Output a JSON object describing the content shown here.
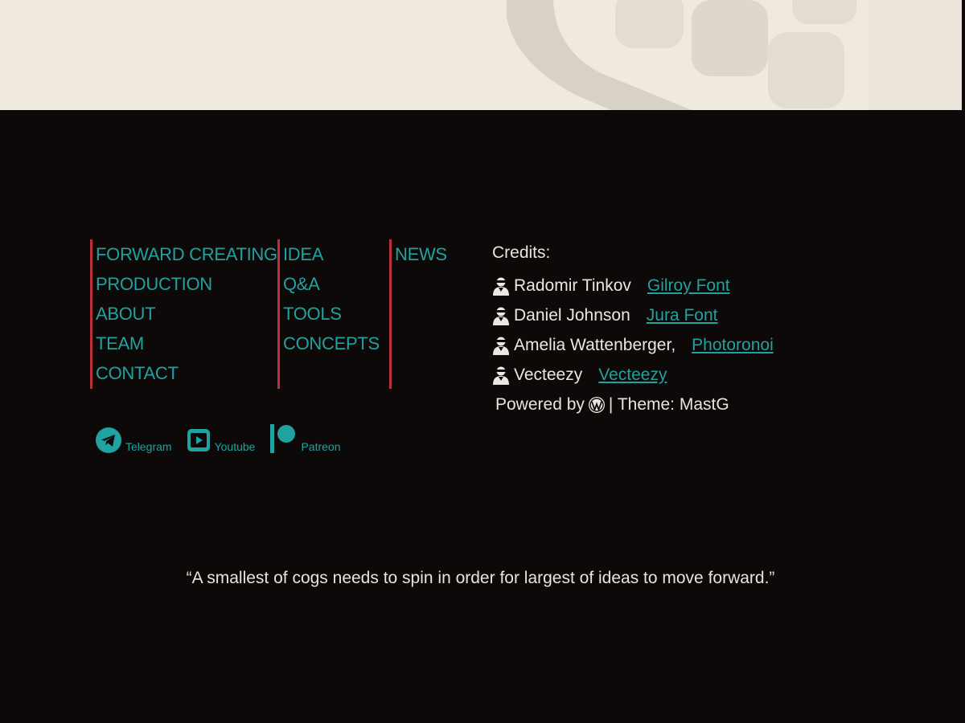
{
  "nav": {
    "col1": [
      "FORWARD CREATING",
      "PRODUCTION",
      "ABOUT",
      "TEAM",
      "CONTACT"
    ],
    "col2": [
      "IDEA",
      "Q&A",
      "TOOLS",
      "CONCEPTS"
    ],
    "col3": [
      "NEWS"
    ]
  },
  "credits": {
    "title": "Credits:",
    "rows": [
      {
        "name": "Radomir Tinkov",
        "source": "Gilroy Font"
      },
      {
        "name": "Daniel Johnson",
        "source": "Jura Font"
      },
      {
        "name": "Amelia Wattenberger,",
        "source": "Photoronoi"
      },
      {
        "name": "Vecteezy",
        "source": "Vecteezy"
      }
    ],
    "powered_prefix": "Powered by",
    "powered_suffix": "| Theme: MastG"
  },
  "socials": {
    "telegram": "Telegram",
    "youtube": "Youtube",
    "patreon": "Patreon"
  },
  "quote": "“A smallest of cogs needs to spin in order for largest of ideas to move forward.”",
  "colors": {
    "accent": "#1fa2a0",
    "divider": "#b8303a",
    "background": "#0c0908",
    "banner": "#f0e9df"
  },
  "icons": [
    "person-icon",
    "wordpress-icon",
    "telegram-icon",
    "youtube-icon",
    "patreon-icon"
  ]
}
